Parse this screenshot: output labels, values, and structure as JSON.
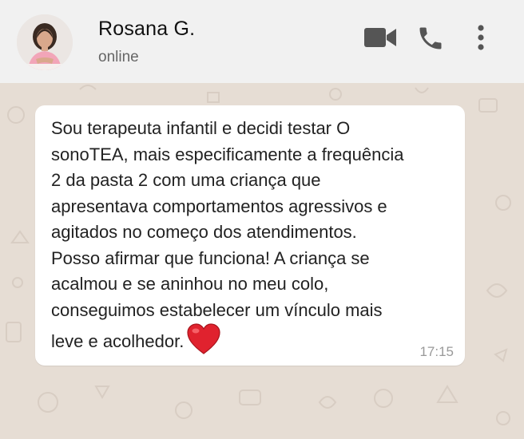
{
  "header": {
    "contact_name": "Rosana G.",
    "status": "online",
    "icons": [
      "avatar",
      "video-call-icon",
      "phone-call-icon",
      "more-options-icon"
    ]
  },
  "message": {
    "text": "Sou terapeuta infantil e decidi testar O\nsonoTEA, mais especificamente a frequência\n2 da pasta 2 com uma criança que\napresentava comportamentos agressivos e\nagitados no começo dos atendimentos.\nPosso afirmar que funciona! A criança se\nacalmou e se aninhou no meu colo,\nconseguimos estabelecer um vínculo mais\nleve e acolhedor.",
    "emoji": "red-heart-icon",
    "time": "17:15"
  },
  "colors": {
    "header_bg": "#f1f1f1",
    "chat_bg": "#e6ddd4",
    "bubble_bg": "#ffffff",
    "icon_color": "#555555",
    "heart": "#e0222e"
  }
}
